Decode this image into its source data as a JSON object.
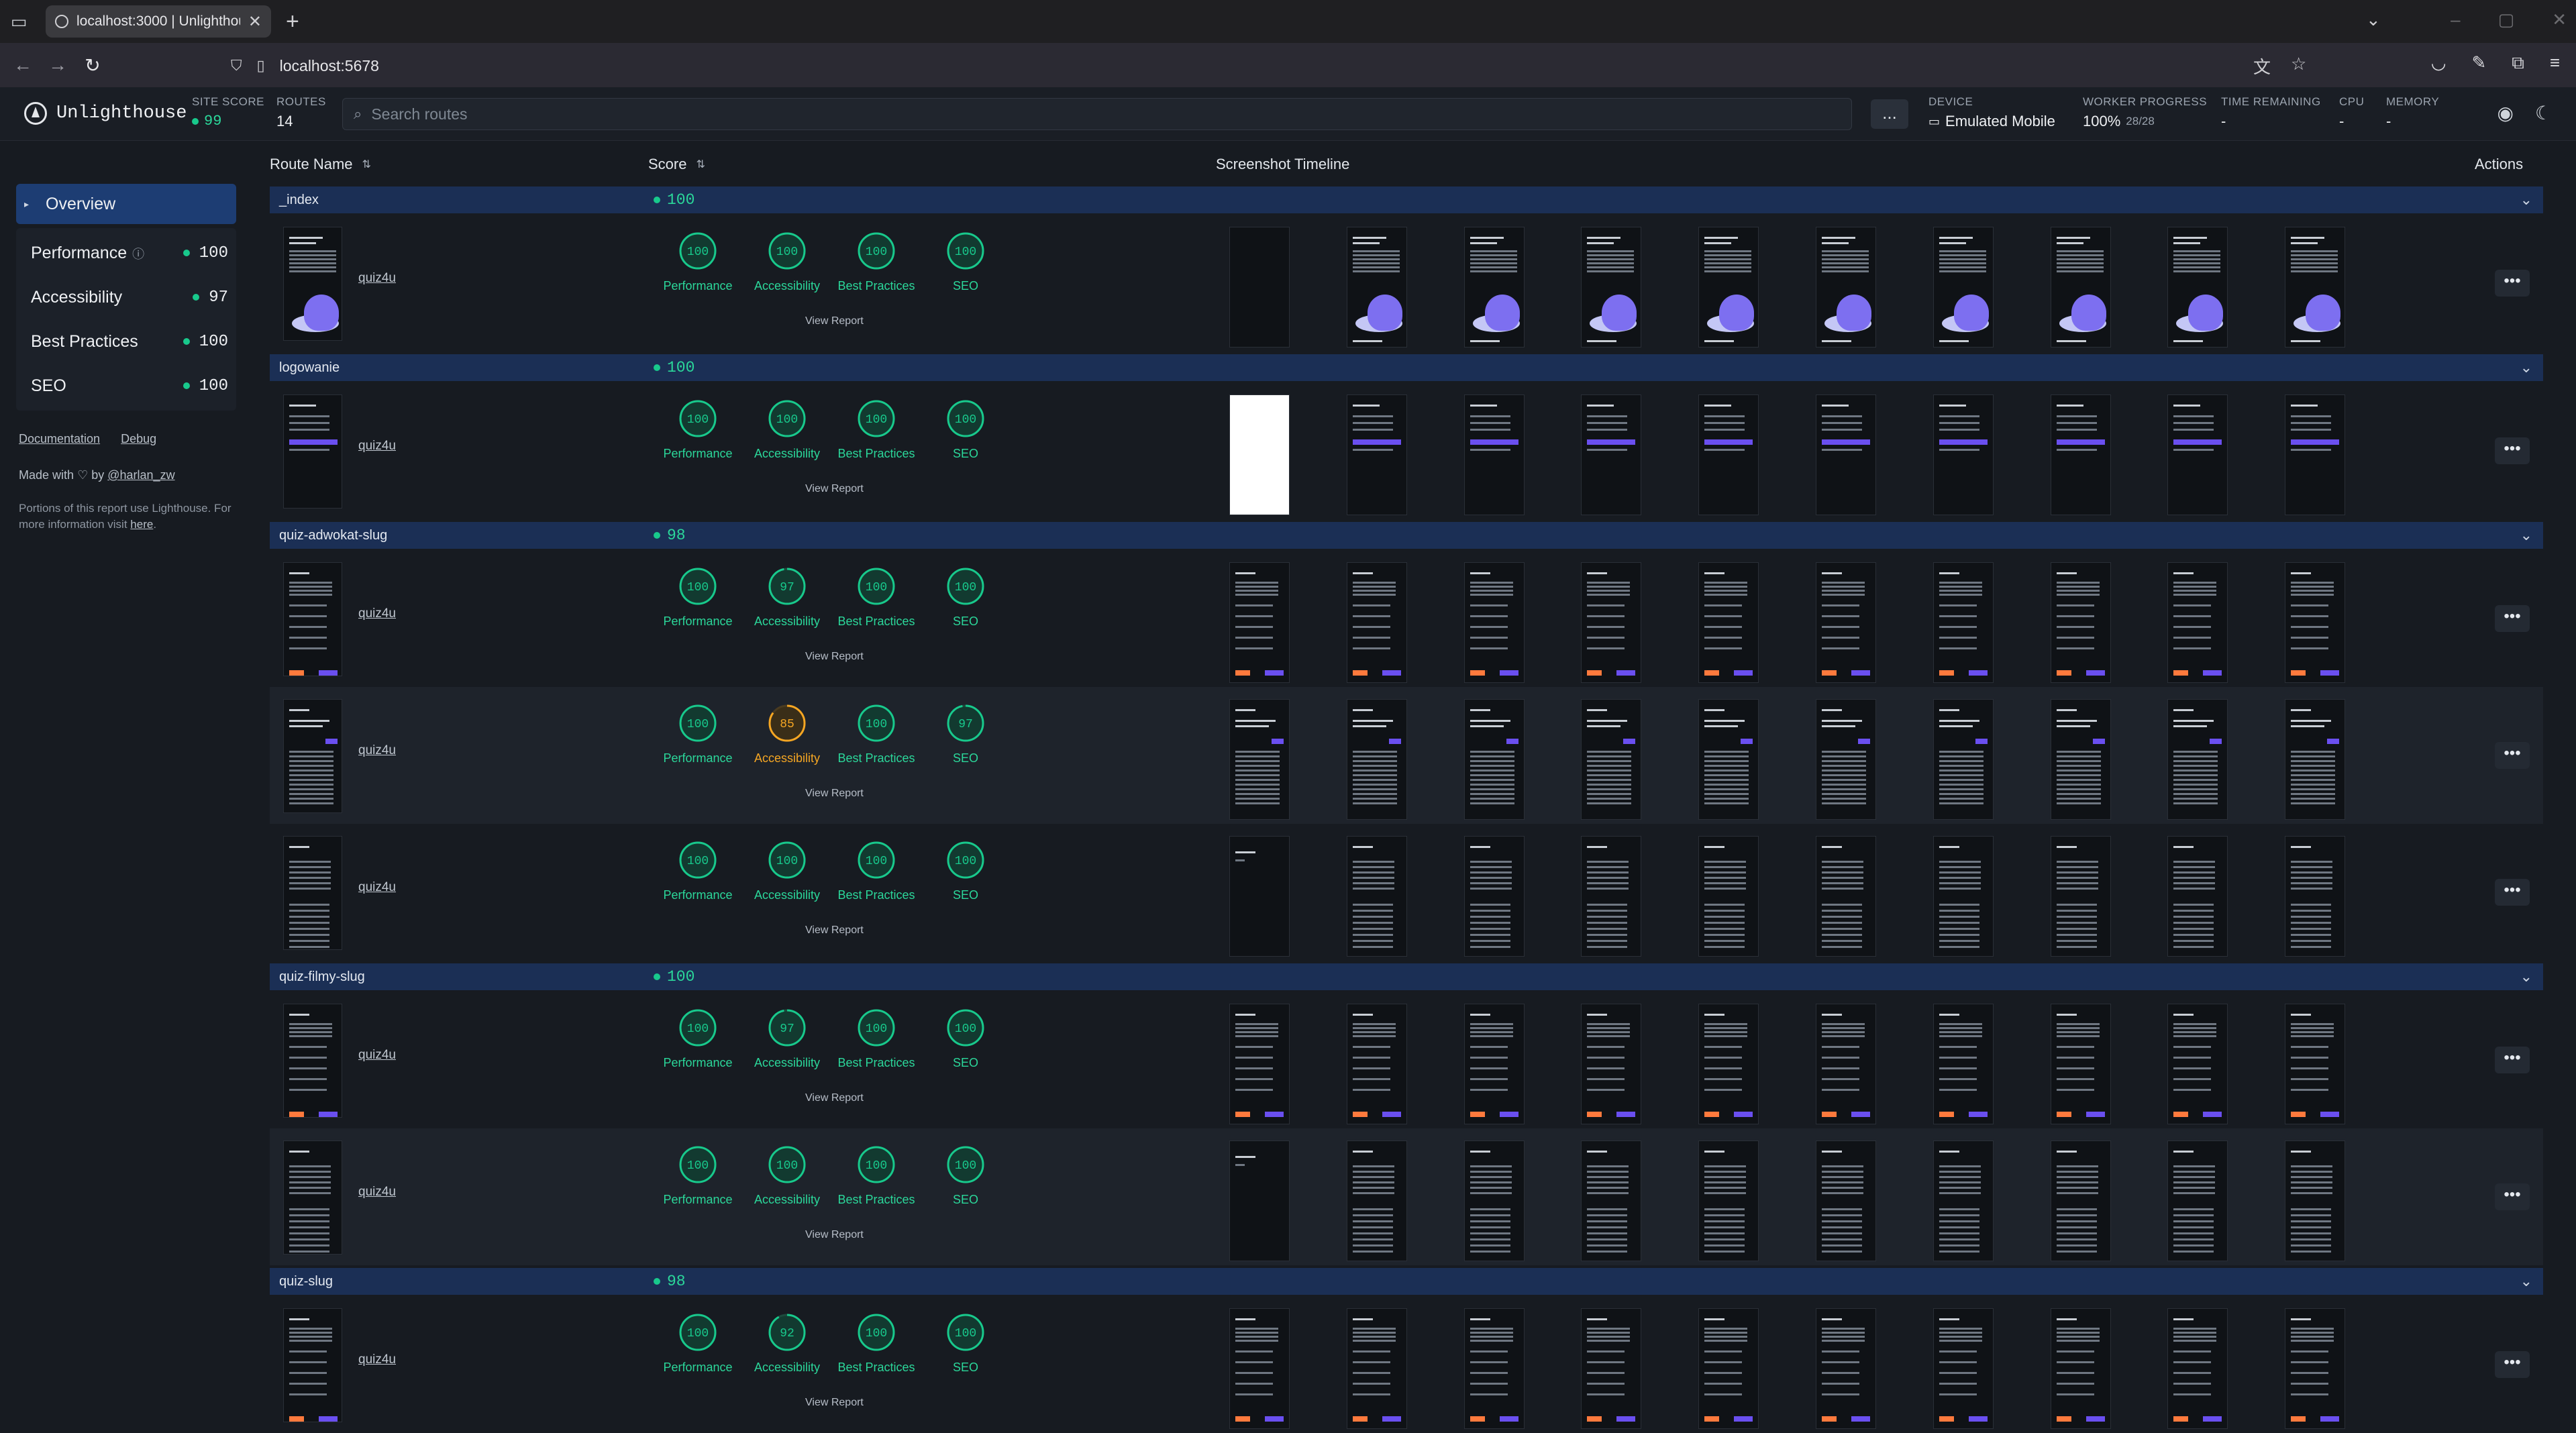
{
  "browser": {
    "tab_title": "localhost:3000 | Unlighthouse",
    "url": "localhost:5678"
  },
  "app": {
    "name": "Unlighthouse",
    "site_score_label": "SITE SCORE",
    "site_score": "99",
    "routes_label": "ROUTES",
    "routes": "14",
    "search_placeholder": "Search routes",
    "more_label": "...",
    "device_label": "DEVICE",
    "device": "Emulated Mobile",
    "worker_label": "WORKER PROGRESS",
    "worker_progress": "100%",
    "worker_count": "28/28",
    "time_label": "TIME REMAINING",
    "time_value": "-",
    "cpu_label": "CPU",
    "cpu_value": "-",
    "memory_label": "MEMORY",
    "memory_value": "-"
  },
  "sidebar": {
    "overview": "Overview",
    "categories": [
      {
        "name": "Performance",
        "score": "100",
        "info": true
      },
      {
        "name": "Accessibility",
        "score": "97",
        "info": false
      },
      {
        "name": "Best Practices",
        "score": "100",
        "info": false
      },
      {
        "name": "SEO",
        "score": "100",
        "info": false
      }
    ],
    "links": {
      "documentation": "Documentation",
      "debug": "Debug"
    },
    "made_with": "Made with",
    "by": "by",
    "author": "@harlan_zw",
    "portions": "Portions of this report use Lighthouse. For more information visit",
    "portions_link": "here",
    "portions_end": "."
  },
  "table": {
    "headers": {
      "route": "Route Name",
      "score": "Score",
      "timeline": "Screenshot Timeline",
      "actions": "Actions"
    },
    "view_report": "View Report",
    "category_labels": [
      "Performance",
      "Accessibility",
      "Best Practices",
      "SEO"
    ],
    "groups": [
      {
        "name": "_index",
        "score": "100",
        "rows": [
          {
            "route": "quiz4u",
            "scores": [
              100,
              100,
              100,
              100
            ],
            "first_shot": "dark",
            "style": "hero"
          }
        ]
      },
      {
        "name": "logowanie",
        "score": "100",
        "rows": [
          {
            "route": "quiz4u",
            "scores": [
              100,
              100,
              100,
              100
            ],
            "first_shot": "white",
            "style": "login"
          }
        ]
      },
      {
        "name": "quiz-adwokat-slug",
        "score": "98",
        "rows": [
          {
            "route": "quiz4u",
            "scores": [
              100,
              97,
              100,
              100
            ],
            "first_shot": "content",
            "style": "list"
          },
          {
            "route": "quiz4u",
            "scores": [
              100,
              85,
              100,
              97
            ],
            "first_shot": "content",
            "style": "quiz"
          },
          {
            "route": "quiz4u",
            "scores": [
              100,
              100,
              100,
              100
            ],
            "first_shot": "sparse",
            "style": "calendar"
          }
        ]
      },
      {
        "name": "quiz-filmy-slug",
        "score": "100",
        "rows": [
          {
            "route": "quiz4u",
            "scores": [
              100,
              97,
              100,
              100
            ],
            "first_shot": "content",
            "style": "list"
          },
          {
            "route": "quiz4u",
            "scores": [
              100,
              100,
              100,
              100
            ],
            "first_shot": "sparse",
            "style": "calendar"
          }
        ]
      },
      {
        "name": "quiz-slug",
        "score": "98",
        "rows": [
          {
            "route": "quiz4u",
            "scores": [
              100,
              92,
              100,
              100
            ],
            "first_shot": "content",
            "style": "list"
          }
        ]
      }
    ]
  },
  "colors": {
    "pass": "#18c98c",
    "average": "#f5a623",
    "group_bg": "#1b2f55",
    "accent": "#1d3d73"
  }
}
